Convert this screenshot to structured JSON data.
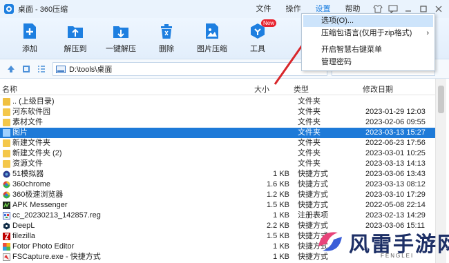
{
  "window": {
    "title": "桌面 - 360压缩"
  },
  "menubar": [
    "文件",
    "操作",
    "设置",
    "帮助"
  ],
  "toolbar": {
    "buttons": [
      {
        "label": "添加",
        "icon": "add-file-icon"
      },
      {
        "label": "解压到",
        "icon": "extract-to-icon"
      },
      {
        "label": "一键解压",
        "icon": "one-click-extract-icon"
      },
      {
        "label": "删除",
        "icon": "trash-icon"
      },
      {
        "label": "图片压缩",
        "icon": "image-compress-icon"
      },
      {
        "label": "工具",
        "icon": "tools-icon",
        "badge": "New"
      }
    ]
  },
  "address": {
    "path": "D:\\tools\\桌面"
  },
  "columns": {
    "name": "名称",
    "size": "大小",
    "type": "类型",
    "date": "修改日期"
  },
  "files": [
    {
      "name": ".. (上级目录)",
      "size": "",
      "type": "文件夹",
      "date": "",
      "icon": "folder-up-icon"
    },
    {
      "name": "河东软件园",
      "size": "",
      "type": "文件夹",
      "date": "2023-01-29 12:03",
      "icon": "folder-icon"
    },
    {
      "name": "素材文件",
      "size": "",
      "type": "文件夹",
      "date": "2023-02-06 09:55",
      "icon": "folder-icon"
    },
    {
      "name": "图片",
      "size": "",
      "type": "文件夹",
      "date": "2023-03-13 15:27",
      "icon": "folder-icon",
      "selected": true
    },
    {
      "name": "新建文件夹",
      "size": "",
      "type": "文件夹",
      "date": "2022-06-23 17:56",
      "icon": "folder-icon"
    },
    {
      "name": "新建文件夹 (2)",
      "size": "",
      "type": "文件夹",
      "date": "2023-03-01 10:25",
      "icon": "folder-icon"
    },
    {
      "name": "资源文件",
      "size": "",
      "type": "文件夹",
      "date": "2023-03-13 14:13",
      "icon": "folder-icon"
    },
    {
      "name": "51模拟器",
      "size": "1 KB",
      "type": "快捷方式",
      "date": "2023-03-06 13:43",
      "icon": "emulator-icon"
    },
    {
      "name": "360chrome",
      "size": "1.6 KB",
      "type": "快捷方式",
      "date": "2023-03-13 08:12",
      "icon": "browser-icon"
    },
    {
      "name": "360极速浏览器",
      "size": "1.2 KB",
      "type": "快捷方式",
      "date": "2023-03-10 17:29",
      "icon": "browser-icon"
    },
    {
      "name": "APK Messenger",
      "size": "1.5 KB",
      "type": "快捷方式",
      "date": "2022-05-08 22:14",
      "icon": "apk-icon"
    },
    {
      "name": "cc_20230213_142857.reg",
      "size": "1 KB",
      "type": "注册表项",
      "date": "2023-02-13 14:29",
      "icon": "reg-file-icon"
    },
    {
      "name": "DeepL",
      "size": "2.2 KB",
      "type": "快捷方式",
      "date": "2023-03-06 15:11",
      "icon": "deepl-icon"
    },
    {
      "name": "filezilla",
      "size": "1.5 KB",
      "type": "快捷方式",
      "date": "",
      "icon": "filezilla-icon"
    },
    {
      "name": "Fotor Photo Editor",
      "size": "1 KB",
      "type": "快捷方式",
      "date": "",
      "icon": "fotor-icon"
    },
    {
      "name": "FSCapture.exe - 快捷方式",
      "size": "1 KB",
      "type": "快捷方式",
      "date": "",
      "icon": "fscapture-icon"
    }
  ],
  "settings_menu": {
    "items": [
      {
        "label": "选项(O)...",
        "highlighted": true
      },
      {
        "label": "压缩包语言(仅用于zip格式)",
        "submenu": "›"
      },
      {
        "label": "开启智慧右键菜单"
      },
      {
        "label": "管理密码"
      }
    ]
  },
  "watermark": {
    "text": "风雷手游网",
    "sub": "FENGLEI"
  },
  "colors": {
    "accent": "#1e7fe0",
    "selection": "#1e7ad8",
    "arrow": "#d8262b"
  }
}
